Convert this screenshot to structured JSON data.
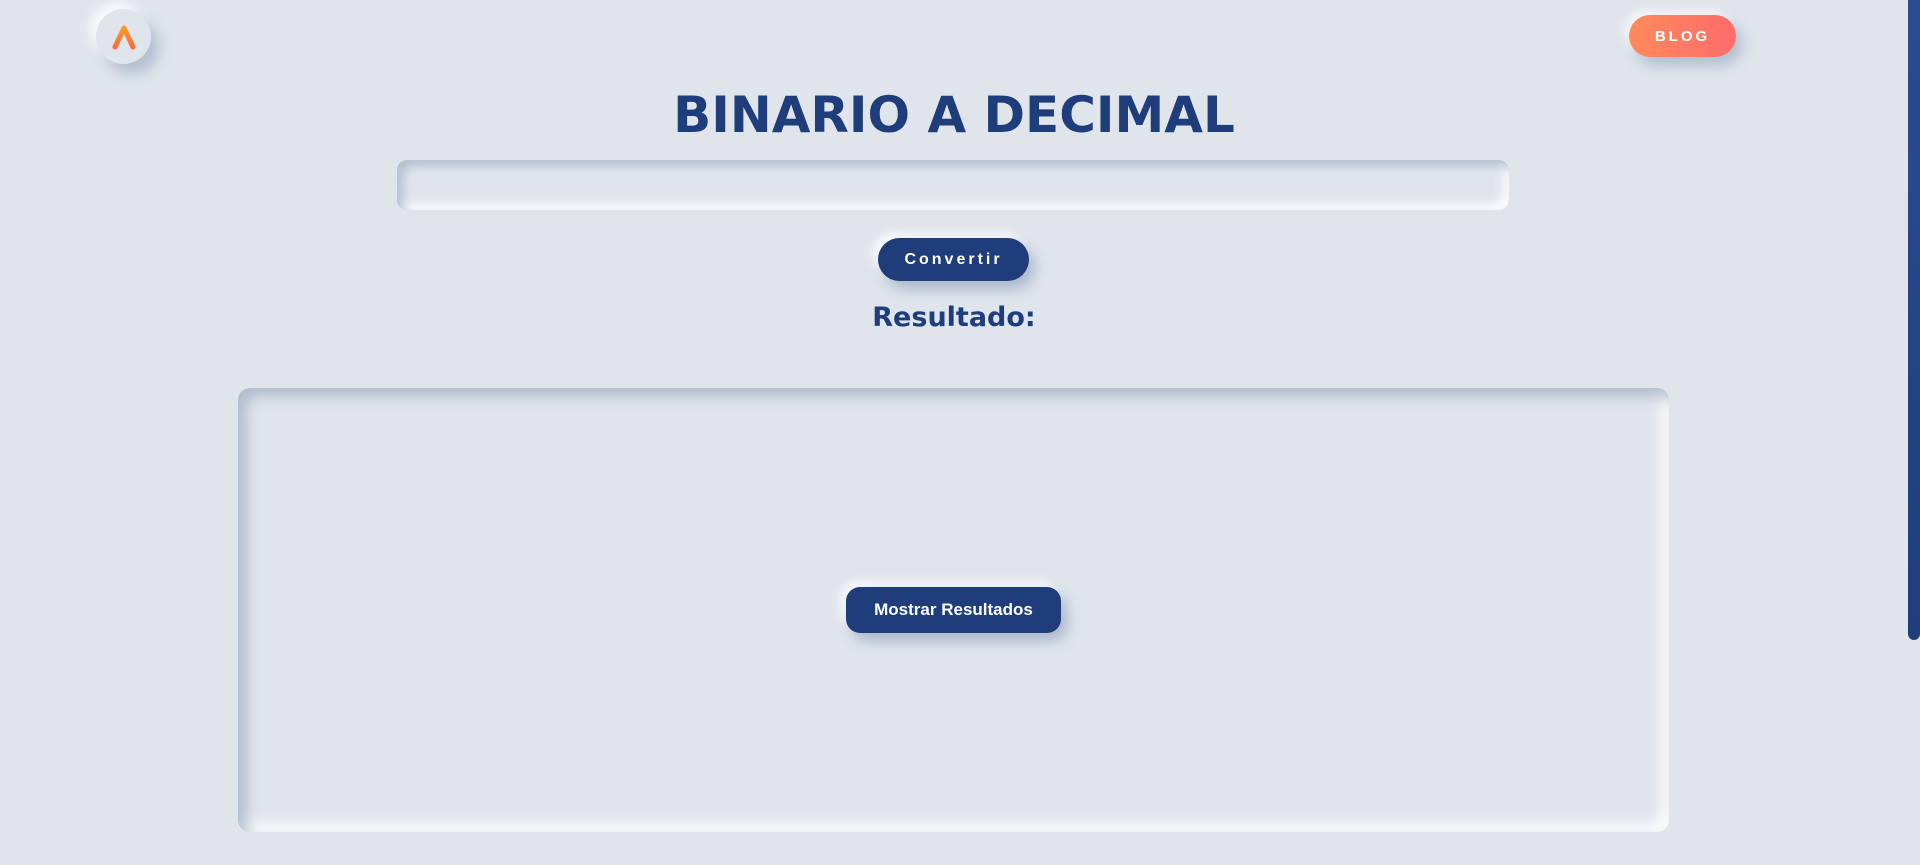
{
  "header": {
    "logo_icon": "arrow-up-logo-icon",
    "blog_label": "BLOG"
  },
  "main": {
    "title": "BINARIO A DECIMAL",
    "binary_input": {
      "value": "",
      "placeholder": ""
    },
    "convert_label": "Convertir",
    "result_label": "Resultado:",
    "show_results_label": "Mostrar Resultados"
  },
  "colors": {
    "background": "#e0e5ec",
    "primary": "#1f3d7a",
    "accent_gradient_start": "#ff8a5c",
    "accent_gradient_end": "#ff6b6b",
    "logo_orange": "#ff8c2a"
  }
}
